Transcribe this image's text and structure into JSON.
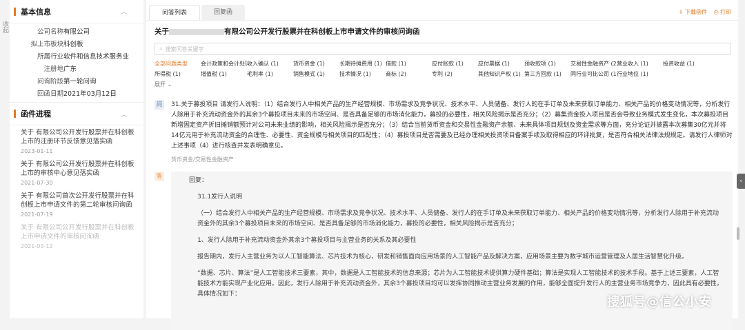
{
  "fold_label": "收起",
  "basic": {
    "title": "基本信息",
    "rows": [
      {
        "k": "公司名称",
        "v": "有限公司"
      },
      {
        "k": "拟上市板块",
        "v": "科创板"
      },
      {
        "k": "所属行业",
        "v": "软件和信息技术服务业"
      },
      {
        "k": "注册地",
        "v": "广东"
      },
      {
        "k": "问询阶段",
        "v": "第一轮问询"
      },
      {
        "k": "回函日期",
        "v": "2021年03月12日"
      }
    ]
  },
  "progress": {
    "title": "函件进程",
    "items": [
      {
        "text": "关于 有限公司公开发行股票并在科创板上市的注册环节反馈意见落实函",
        "date": "2023-01-11"
      },
      {
        "text": "关于 有限公司公开发行股票并在科创板上市的审核中心意见落实函",
        "date": "2021-07-30"
      },
      {
        "text": "关于 有限公司首次公开发行股票并在科创板上市申请文件的第二轮审核问询函",
        "date": "2021-07-19"
      },
      {
        "text": "关于 有限公司公开发行股票并在科创板上市申请文件的审核问询函",
        "date": "2021-03-12"
      }
    ]
  },
  "tabs": [
    "问答列表",
    "回复函"
  ],
  "tools": {
    "download": "下载函件",
    "print": "打印"
  },
  "doc_title_pre": "关于",
  "doc_title_post": "有限公司公开发行股票并在科创板上市申请文件的审核问询函",
  "search_placeholder": "搜索问答关键字",
  "categories": [
    "全部问题类型",
    "会计政策和会计处理 (1)",
    "收入确认 (1)",
    "货币资金 (1)",
    "长期待摊费用 (1)",
    "借款 (1)",
    "应付账款 (1)",
    "应付票据 (1)",
    "预收款项 (1)",
    "交易性金融资产 (2)",
    "营业收入 (1)",
    "投资收益 (1)",
    "所得税 (1)",
    "增值税 (1)",
    "毛利率 (1)",
    "销售模式 (1)",
    "技术情况 (1)",
    "商标 (2)",
    "专利 (2)",
    "其他知识产权 (1)",
    "第三方回款 (1)",
    "同行业可比公司 (1)",
    "行业地位 (1)"
  ],
  "expand": "展开",
  "question": {
    "badge": "问",
    "text": "31.关于募投项目 请发行人说明：（1）结合发行人中相关产品的生产经营规模、市场需求及竞争状况、技术水平、人员储备、发行人的在手订单及未来获取订单能力、相关产品的价格变动情况等，分析发行人除用于补充流动资金外的其余3个募投项目未来的市场空间、是否具备足够的市场消化能力，募投的必要性，相关风险揭示是否充分；（2）募集资金投入项目是否会导致业务模式发生变化，本次募投项目新增固定资产折旧摊销额预计对公司未来业绩的影响，相关风险揭示是否充分；（3）结合当前货币资金和交易性金融资产余额、未来具体项目规划及资金需求等方面，充分论证并披露本次募集30亿元并将14亿元用于补充流动资金的合理性、必要性、资金规模与相关项目的匹配性；（4）募投项目是否需要及已经办理相关投资项目备案手续及取得相应的环评批复，是否符合相关法律法规规定。请发行人律师对上述事项（4）进行核查并发表明确意见。",
    "tag": "货币资金/交易性金融资产"
  },
  "answer": {
    "badge": "答",
    "p1": "回复：",
    "p2": "31.1发行人说明",
    "p3": "（一）结合发行人中相关产品的生产经营规模、市场需求及竞争状况、技术水平、人员储备、发行人的在手订单及未来获取订单能力、相关产品的价格变动情况等，分析发行人除用于补充流动资金外的其余3个募投项目未来的市场空间、是否具备足够的市场消化能力，募投的必要性，相关风险揭示是否充分；",
    "p4": "1、发行人除用于补充流动资金外其余3个募投项目与主营业务的关系及其必要性",
    "p5": "报告期内，发行人主营业务为以人工智能算法、芯片技术为核心，研发和销售面向应用场景的人工智能产品及解决方案，应用场景主要为数字城市运营管理及人居生活智慧化升级。",
    "p6": "“数据、芯片、算法”是人工智能技术三要素，其中，数据是人工智能技术的信息来源；芯片为人工智能技术提供算力硬件基础；算法是实现人工智能技术的技术手段。基于上述三要素，人工智能技术方能实现产业化应用。因此，发行人除用于补充流动资金外，其余3个募投项目均可以发挥协同推动主营业务发展的作用，能够全面提升发行人的主营业务市场竞争力，因此具有必要性，具体情况如下："
  },
  "watermark": "搜狐号@信公小安",
  "colors": {
    "accent": "#e07a28"
  }
}
